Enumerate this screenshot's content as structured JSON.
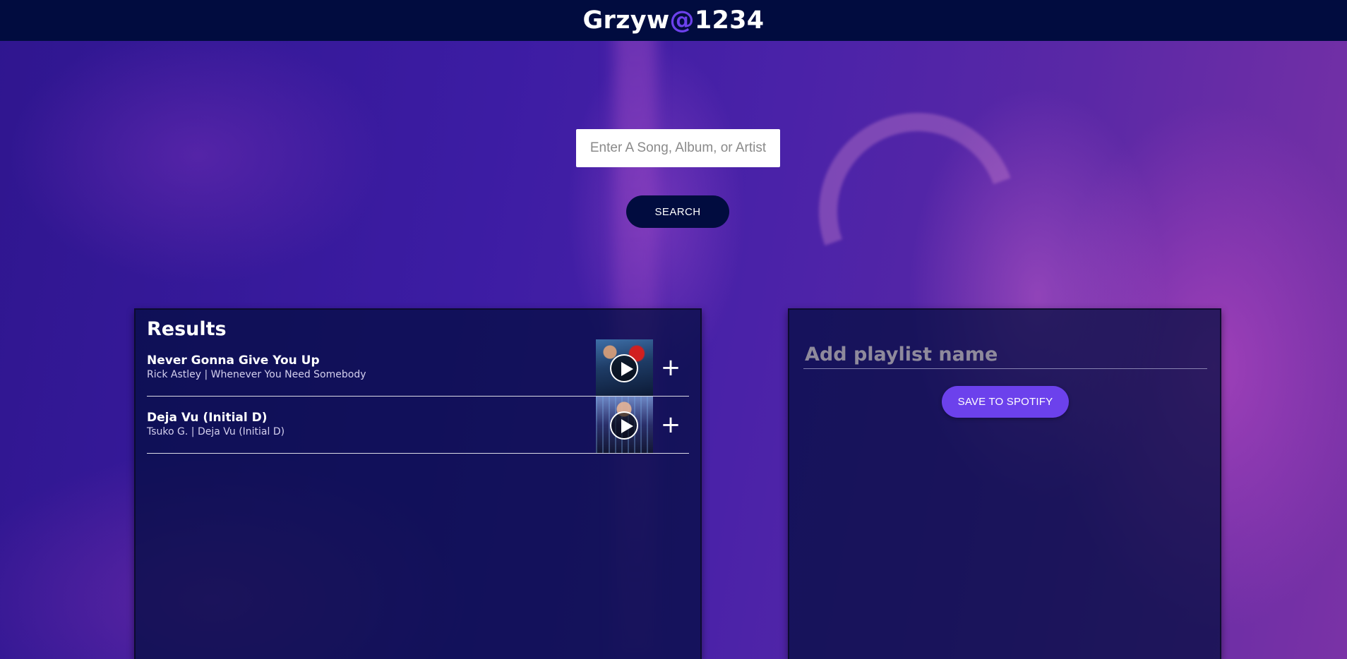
{
  "header": {
    "title_prefix": "Grzyw",
    "title_accent": "@",
    "title_suffix": "1234"
  },
  "search": {
    "placeholder": "Enter A Song, Album, or Artist",
    "value": "",
    "button_label": "SEARCH"
  },
  "results": {
    "title": "Results",
    "tracks": [
      {
        "name": "Never Gonna Give You Up",
        "meta": "Rick Astley | Whenever You Need Somebody",
        "add_label": "+"
      },
      {
        "name": "Deja Vu (Initial D)",
        "meta": "Tsuko G. | Deja Vu (Initial D)",
        "add_label": "+"
      }
    ]
  },
  "playlist": {
    "name_placeholder": "Add playlist name",
    "name_value": "",
    "save_label": "SAVE TO SPOTIFY"
  },
  "colors": {
    "header_bg": "#010c3f",
    "accent": "#6c41ec",
    "panel_bg": "#010c3f"
  }
}
